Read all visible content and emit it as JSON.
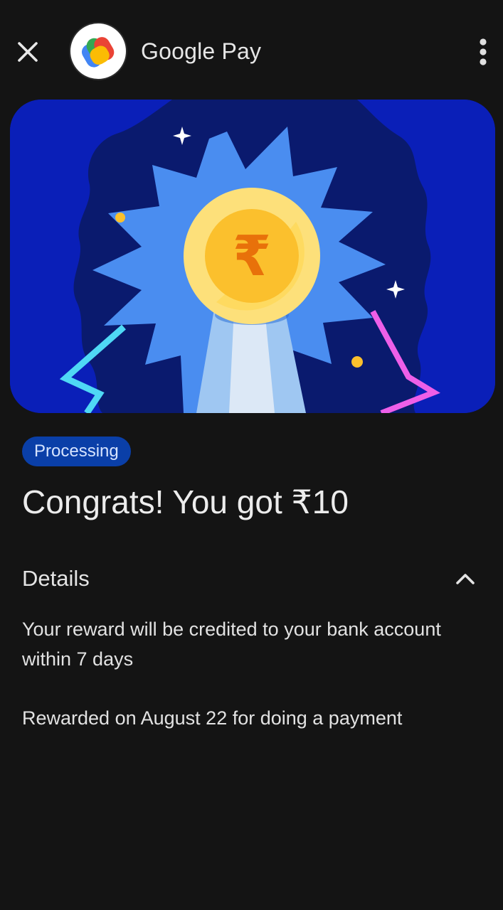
{
  "header": {
    "app_title": "Google Pay",
    "close_icon": "close-icon",
    "more_icon": "more-vert-icon",
    "logo_icon": "google-pay-logo"
  },
  "hero": {
    "illustration": "rupee-coin-medal-illustration",
    "currency_symbol": "₹",
    "colors": {
      "background": "#0a1fb8",
      "dark_blob": "#0a1a6e",
      "burst": "#4a8df0",
      "coin": "#fbc02d",
      "coin_symbol": "#e8710a"
    }
  },
  "status": {
    "label": "Processing",
    "color": "#0a3fa8"
  },
  "reward": {
    "headline": "Congrats! You got ₹10"
  },
  "details": {
    "title": "Details",
    "toggle_icon": "chevron-up-icon",
    "expanded": true,
    "lines": [
      "Your reward will be credited to your bank account within 7 days",
      "Rewarded on August 22 for doing a payment"
    ]
  }
}
